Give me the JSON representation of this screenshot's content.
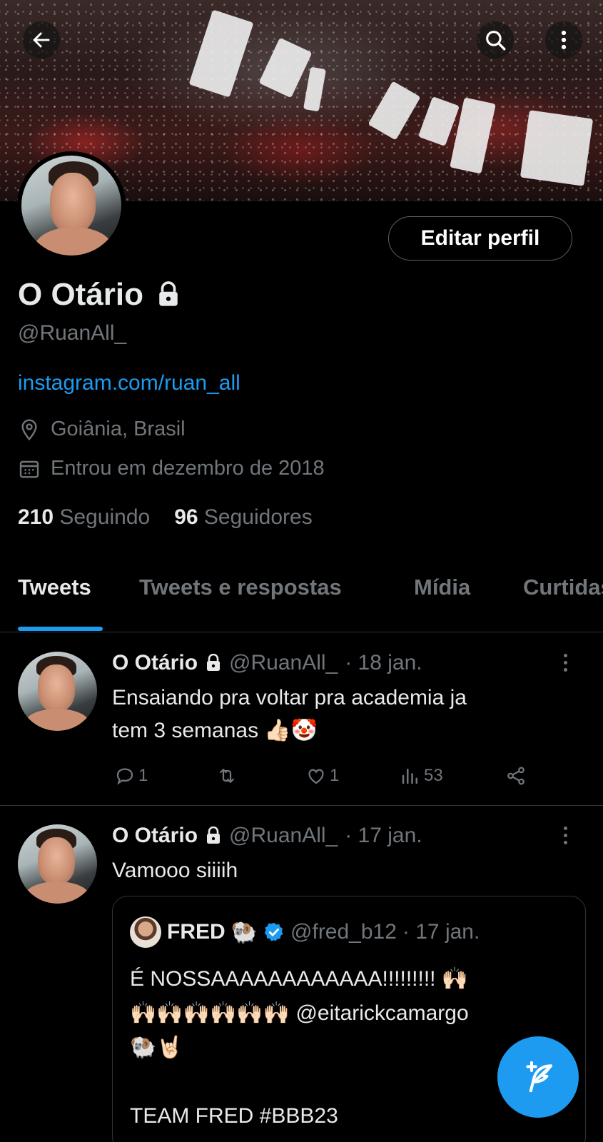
{
  "profile": {
    "name": "O Otário",
    "handle": "@RuanAll_",
    "link": "instagram.com/ruan_all",
    "location": "Goiânia, Brasil",
    "joined": "Entrou em dezembro de 2018",
    "following_count": "210",
    "following_label": "Seguindo",
    "followers_count": "96",
    "followers_label": "Seguidores",
    "edit_label": "Editar perfil"
  },
  "tabs": [
    {
      "label": "Tweets",
      "active": true
    },
    {
      "label": "Tweets e respostas",
      "active": false
    },
    {
      "label": "Mídia",
      "active": false
    },
    {
      "label": "Curtidas",
      "active": false
    }
  ],
  "tweets": [
    {
      "name": "O Otário",
      "handle": "@RuanAll_",
      "date": "· 18 jan.",
      "text_line1": "Ensaiando pra voltar pra academia ja",
      "text_line2": "tem 3 semanas 👍🏻🤡",
      "replies": "1",
      "retweets": "",
      "likes": "1",
      "views": "53"
    },
    {
      "name": "O Otário",
      "handle": "@RuanAll_",
      "date": "· 17 jan.",
      "text": "Vamooo siiiih",
      "quote": {
        "name": "FRED",
        "name_emoji": "🐏",
        "handle": "@fred_b12",
        "date": "· 17 jan.",
        "line1": "É NOSSAAAAAAAAAAAA!!!!!!!!! 🙌🏻",
        "line2": "🙌🏻🙌🏻🙌🏻🙌🏻🙌🏻🙌🏻 @eitarickcamargo",
        "line3": "🐏🤘🏻",
        "line4": "TEAM FRED #BBB23"
      }
    }
  ],
  "icons": {
    "back": "back-arrow-icon",
    "search": "search-icon",
    "more": "more-vertical-icon",
    "lock": "lock-icon",
    "location": "location-pin-icon",
    "calendar": "calendar-icon",
    "reply": "reply-icon",
    "retweet": "retweet-icon",
    "like": "heart-icon",
    "views": "views-icon",
    "share": "share-icon",
    "verified": "verified-badge-icon",
    "compose": "compose-tweet-icon"
  },
  "colors": {
    "accent": "#1d9bf0",
    "background": "#000000",
    "text_primary": "#e7e9ea",
    "text_secondary": "#71767b",
    "border": "#2f3336"
  }
}
